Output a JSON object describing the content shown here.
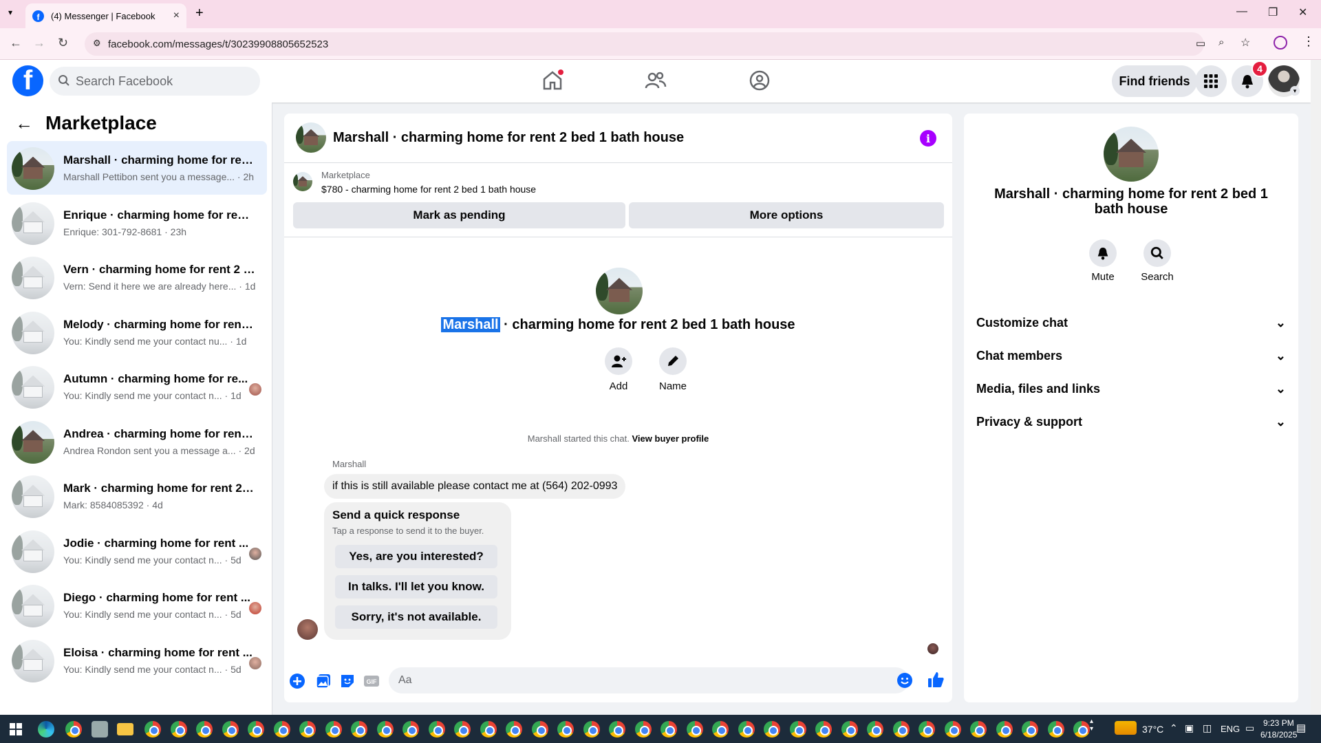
{
  "browser": {
    "tab_title": "(4) Messenger | Facebook",
    "url": "facebook.com/messages/t/30239908805652523"
  },
  "fb": {
    "search_placeholder": "Search Facebook",
    "find_friends": "Find friends",
    "notif_count": "4"
  },
  "sidebar": {
    "title": "Marketplace",
    "conversations": [
      {
        "name": "Marshall · charming home for rent...",
        "preview": "Marshall Pettibon sent you a message...",
        "time": "· 2h",
        "active": true
      },
      {
        "name": "Enrique · charming home for rent ...",
        "preview": "Enrique: 301-792-8681",
        "time": "· 23h"
      },
      {
        "name": "Vern · charming home for rent 2 b...",
        "preview": "Vern: Send it here we are already here...",
        "time": "· 1d"
      },
      {
        "name": "Melody · charming home for rent ...",
        "preview": "You: Kindly send me your contact nu...",
        "time": "· 1d"
      },
      {
        "name": "Autumn · charming home for re...",
        "preview": "You: Kindly send me your contact n...",
        "time": "· 1d"
      },
      {
        "name": "Andrea · charming home for rent ...",
        "preview": "Andrea Rondon sent you a message a...",
        "time": "· 2d"
      },
      {
        "name": "Mark · charming home for rent 2 b...",
        "preview": "Mark: 8584085392",
        "time": "· 4d"
      },
      {
        "name": "Jodie · charming home for rent ...",
        "preview": "You: Kindly send me your contact n...",
        "time": "· 5d"
      },
      {
        "name": "Diego · charming home for rent ...",
        "preview": "You: Kindly send me your contact n...",
        "time": "· 5d"
      },
      {
        "name": "Eloisa · charming home for rent ...",
        "preview": "You: Kindly send me your contact n...",
        "time": "· 5d"
      }
    ]
  },
  "chat": {
    "title": "Marshall · charming home for rent 2 bed 1 bath house",
    "marketplace_label": "Marketplace",
    "listing": "$780 - charming home for rent 2 bed 1 bath house",
    "mark_pending": "Mark as pending",
    "more_options": "More options",
    "intro_name": "Marshall",
    "intro_rest": " · charming home for rent 2 bed 1 bath house",
    "add_label": "Add",
    "name_label": "Name",
    "started_text": "Marshall started this chat.",
    "view_profile": "View buyer profile",
    "sender": "Marshall",
    "message": "if this is still available please contact me at (564) 202-0993",
    "quick_title": "Send a quick response",
    "quick_sub": "Tap a response to send it to the buyer.",
    "quick_replies": [
      "Yes, are you interested?",
      "In talks. I'll let you know.",
      "Sorry, it's not available."
    ],
    "input_placeholder": "Aa"
  },
  "right_panel": {
    "title": "Marshall · charming home for rent 2 bed 1 bath house",
    "mute": "Mute",
    "search": "Search",
    "sections": [
      "Customize chat",
      "Chat members",
      "Media, files and links",
      "Privacy & support"
    ]
  },
  "taskbar": {
    "temp": "37°C",
    "lang": "ENG",
    "time": "9:23 PM",
    "date": "6/18/2025"
  },
  "colors": {
    "fb_blue": "#0866ff",
    "messenger_purple": "#a700ff",
    "badge_red": "#e41e3f"
  }
}
